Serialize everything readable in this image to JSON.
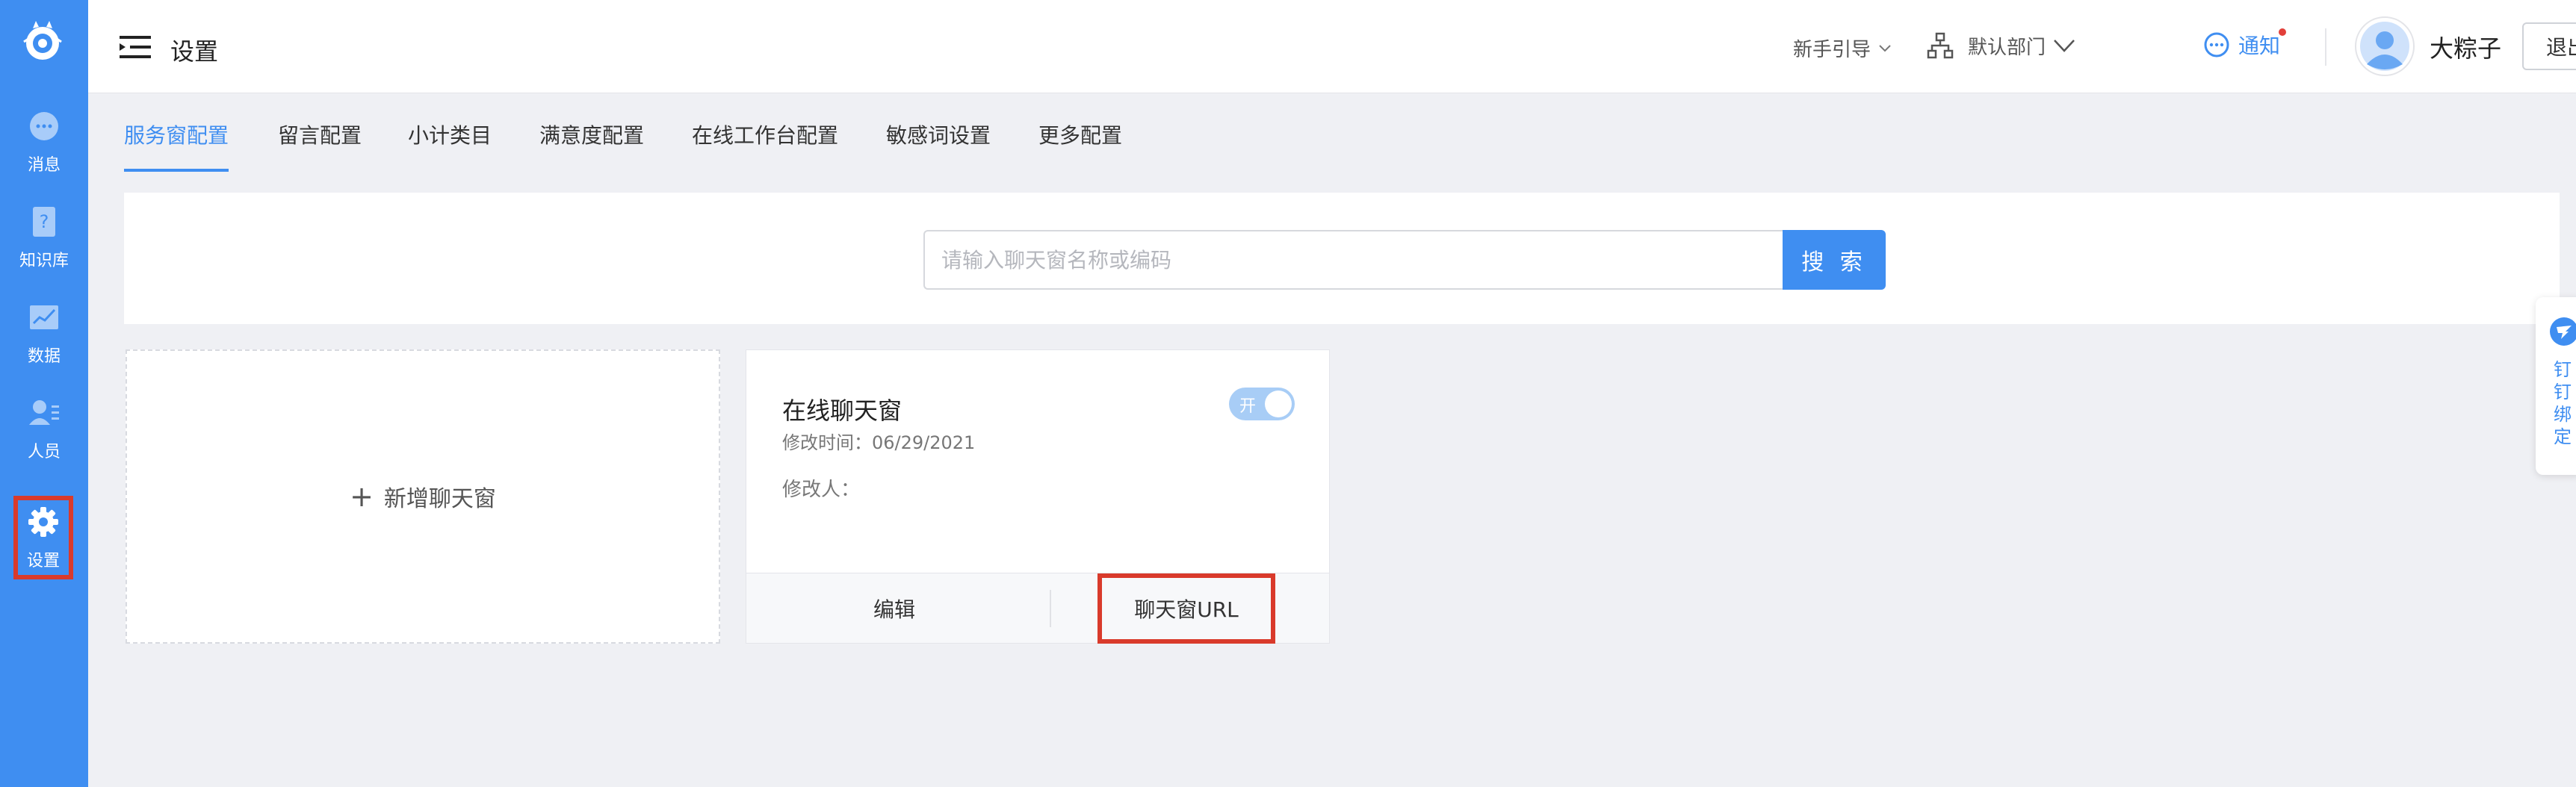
{
  "colors": {
    "brand": "#3f8ef1",
    "highlight_red": "#d93a2b",
    "notify_dot": "#e2403a",
    "toggle_on": "#a8cdf6"
  },
  "sidebar": {
    "logo": "logo-icon",
    "items": [
      {
        "label": "消息",
        "icon": "chat-bubble-icon"
      },
      {
        "label": "知识库",
        "icon": "question-book-icon"
      },
      {
        "label": "数据",
        "icon": "line-chart-icon"
      },
      {
        "label": "人员",
        "icon": "people-icon"
      },
      {
        "label": "设置",
        "icon": "gear-icon",
        "active": true
      }
    ]
  },
  "header": {
    "title": "设置",
    "guide": "新手引导",
    "department": "默认部门",
    "notify": "通知",
    "user_name": "大粽子",
    "logout": "退出登录"
  },
  "tabs": [
    {
      "label": "服务窗配置",
      "active": true
    },
    {
      "label": "留言配置"
    },
    {
      "label": "小计类目"
    },
    {
      "label": "满意度配置"
    },
    {
      "label": "在线工作台配置"
    },
    {
      "label": "敏感词设置"
    },
    {
      "label": "更多配置"
    }
  ],
  "search": {
    "placeholder": "请输入聊天窗名称或编码",
    "value": "",
    "button": "搜 索"
  },
  "add_card": {
    "plus": "+",
    "label": "新增聊天窗"
  },
  "chat_card": {
    "title": "在线聊天窗",
    "modified": "修改时间：06/29/2021",
    "modifier": "修改人：",
    "toggle_label": "开",
    "toggle_on": true,
    "edit": "编辑",
    "url": "聊天窗URL"
  },
  "float": {
    "text": "钉钉绑定"
  }
}
